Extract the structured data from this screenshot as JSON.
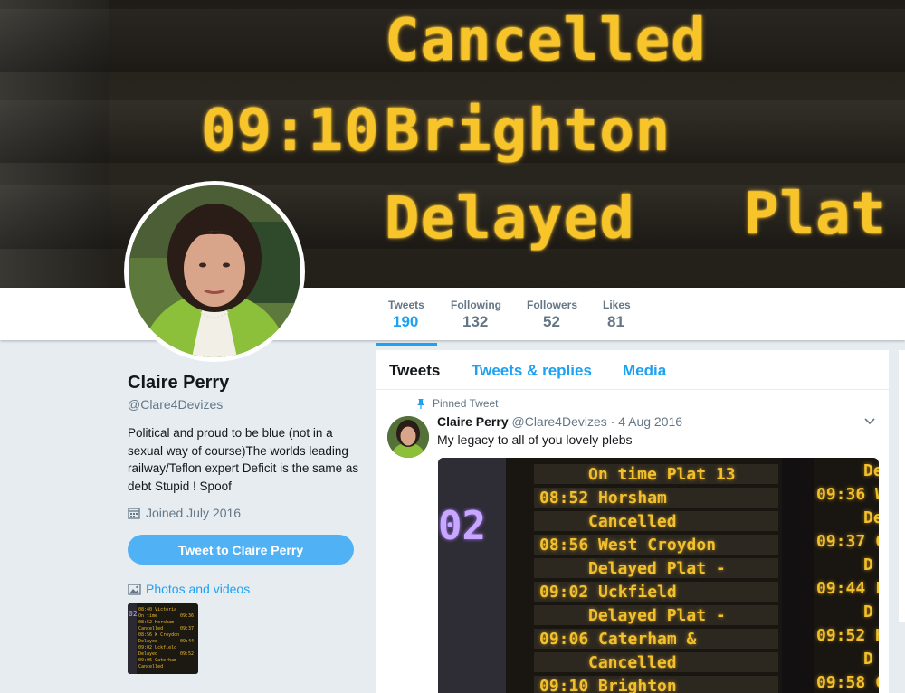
{
  "banner": {
    "rows": [
      {
        "time": "",
        "destination": "Cancelled",
        "status": ""
      },
      {
        "time": "09:10",
        "destination": "Brighton",
        "status": ""
      },
      {
        "time": "",
        "destination": "Delayed",
        "status": "Plat -"
      }
    ]
  },
  "nav": {
    "stats": [
      {
        "label": "Tweets",
        "value": "190"
      },
      {
        "label": "Following",
        "value": "132"
      },
      {
        "label": "Followers",
        "value": "52"
      },
      {
        "label": "Likes",
        "value": "81"
      }
    ],
    "active_color": "#1da1f2"
  },
  "profile": {
    "name": "Claire Perry",
    "handle": "@Clare4Devizes",
    "bio": "Political and proud to be blue (not in a sexual way of course)The worlds leading railway/Teflon expert Deficit is the same as debt Stupid ! Spoof",
    "joined": "Joined July 2016",
    "tweet_to_label": "Tweet to Claire Perry",
    "photos_label": "Photos and videos",
    "calendar_icon": "calendar-icon",
    "photo_icon": "photo-icon"
  },
  "timeline": {
    "tabs": [
      {
        "label": "Tweets"
      },
      {
        "label": "Tweets & replies"
      },
      {
        "label": "Media"
      }
    ],
    "pinned_label": "Pinned Tweet",
    "tweet": {
      "name": "Claire Perry",
      "handle": "@Clare4Devizes",
      "separator": "·",
      "date": "4 Aug 2016",
      "text": "My legacy to all of you lovely plebs"
    },
    "board": {
      "left_lines": [
        "On time   Plat 13",
        "08:52 Horsham",
        "Cancelled",
        "08:56 West Croydon",
        "Delayed    Plat -",
        "09:02 Uckfield",
        "Delayed    Plat -",
        "09:06 Caterham &",
        "Cancelled",
        "09:10 Brighton"
      ],
      "right_lines": [
        "De",
        "09:36 W",
        "De",
        "09:37 C",
        "D",
        "09:44 L",
        "D",
        "09:52 H",
        "D",
        "09:58 C"
      ],
      "platform_number": "02"
    }
  },
  "colors": {
    "accent": "#1da1f2",
    "led": "#f7c52a",
    "page_bg": "#e6ecf0"
  }
}
